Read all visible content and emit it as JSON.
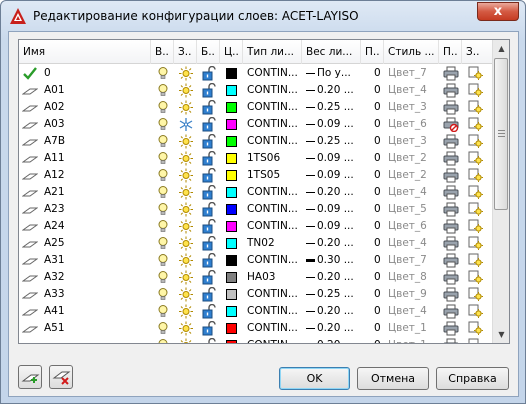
{
  "window": {
    "title": "Редактирование конфигурации слоев: ACET-LAYISO",
    "close_label": "x"
  },
  "columns": [
    "Имя",
    "В..",
    "З..",
    "Б..",
    "Ц..",
    "Тип ли...",
    "Вес ли...",
    "П..",
    "Стиль ...",
    "П..",
    "З.."
  ],
  "rows": [
    {
      "name": "0",
      "current": true,
      "frozen": false,
      "color": "#000000",
      "linetype": "CONTIN...",
      "weight": "По у...",
      "weight_style": "thin",
      "p": "0",
      "style": "Цвет_7",
      "plot": true
    },
    {
      "name": "A01",
      "current": false,
      "frozen": false,
      "color": "#00ffff",
      "linetype": "CONTIN...",
      "weight": "0.20 ...",
      "weight_style": "thin",
      "p": "0",
      "style": "Цвет_4",
      "plot": true
    },
    {
      "name": "A02",
      "current": false,
      "frozen": false,
      "color": "#00ff00",
      "linetype": "CONTIN...",
      "weight": "0.25 ...",
      "weight_style": "thin",
      "p": "0",
      "style": "Цвет_3",
      "plot": true
    },
    {
      "name": "A03",
      "current": false,
      "frozen": true,
      "color": "#ff00ff",
      "linetype": "CONTIN...",
      "weight": "0.09 ...",
      "weight_style": "thin",
      "p": "0",
      "style": "Цвет_6",
      "plot": false
    },
    {
      "name": "A7B",
      "current": false,
      "frozen": false,
      "color": "#00ff00",
      "linetype": "CONTIN...",
      "weight": "0.25 ...",
      "weight_style": "thin",
      "p": "0",
      "style": "Цвет_3",
      "plot": true
    },
    {
      "name": "A11",
      "current": false,
      "frozen": false,
      "color": "#ffff00",
      "linetype": "1TS06",
      "weight": "0.09 ...",
      "weight_style": "thin",
      "p": "0",
      "style": "Цвет_2",
      "plot": true
    },
    {
      "name": "A12",
      "current": false,
      "frozen": false,
      "color": "#ffff00",
      "linetype": "1TS05",
      "weight": "0.09 ...",
      "weight_style": "thin",
      "p": "0",
      "style": "Цвет_2",
      "plot": true
    },
    {
      "name": "A21",
      "current": false,
      "frozen": false,
      "color": "#00ffff",
      "linetype": "CONTIN...",
      "weight": "0.20 ...",
      "weight_style": "thin",
      "p": "0",
      "style": "Цвет_4",
      "plot": true
    },
    {
      "name": "A23",
      "current": false,
      "frozen": false,
      "color": "#0000ff",
      "linetype": "CONTIN...",
      "weight": "0.09 ...",
      "weight_style": "thin",
      "p": "0",
      "style": "Цвет_5",
      "plot": true
    },
    {
      "name": "A24",
      "current": false,
      "frozen": false,
      "color": "#ff00ff",
      "linetype": "CONTIN...",
      "weight": "0.09 ...",
      "weight_style": "thin",
      "p": "0",
      "style": "Цвет_6",
      "plot": true
    },
    {
      "name": "A25",
      "current": false,
      "frozen": false,
      "color": "#00ffff",
      "linetype": "TN02",
      "weight": "0.20 ...",
      "weight_style": "thin",
      "p": "0",
      "style": "Цвет_4",
      "plot": true
    },
    {
      "name": "A31",
      "current": false,
      "frozen": false,
      "color": "#000000",
      "linetype": "CONTIN...",
      "weight": "0.30 ...",
      "weight_style": "thick",
      "p": "0",
      "style": "Цвет_7",
      "plot": true
    },
    {
      "name": "A32",
      "current": false,
      "frozen": false,
      "color": "#808080",
      "linetype": "HA03",
      "weight": "0.20 ...",
      "weight_style": "thin",
      "p": "0",
      "style": "Цвет_8",
      "plot": true
    },
    {
      "name": "A33",
      "current": false,
      "frozen": false,
      "color": "#c0c0c0",
      "linetype": "CONTIN...",
      "weight": "0.25 ...",
      "weight_style": "thin",
      "p": "0",
      "style": "Цвет_9",
      "plot": true
    },
    {
      "name": "A41",
      "current": false,
      "frozen": false,
      "color": "#00ffff",
      "linetype": "CONTIN...",
      "weight": "0.20 ...",
      "weight_style": "thin",
      "p": "0",
      "style": "Цвет_4",
      "plot": true
    },
    {
      "name": "A51",
      "current": false,
      "frozen": false,
      "color": "#ff0000",
      "linetype": "CONTIN...",
      "weight": "0.20 ...",
      "weight_style": "thin",
      "p": "0",
      "style": "Цвет_1",
      "plot": true
    },
    {
      "name": "",
      "current": false,
      "frozen": false,
      "color": "#ff0000",
      "linetype": "CONTIN...",
      "weight": "0.20 ...",
      "weight_style": "thin",
      "p": "0",
      "style": "Цвет_1",
      "plot": true
    }
  ],
  "buttons": {
    "ok": "OK",
    "cancel": "Отмена",
    "help": "Справка"
  },
  "icons": {
    "current": "check-icon",
    "layer": "layer-sheet-icon",
    "on": "lightbulb-icon",
    "thawed": "sun-icon",
    "frozen": "snowflake-icon",
    "unlocked": "open-padlock-icon",
    "plot": "printer-icon",
    "no_plot": "printer-no-plot-icon",
    "freeze_vp": "sun-in-viewport-icon",
    "new_layer": "new-layer-icon",
    "delete_layer": "delete-layer-icon"
  }
}
